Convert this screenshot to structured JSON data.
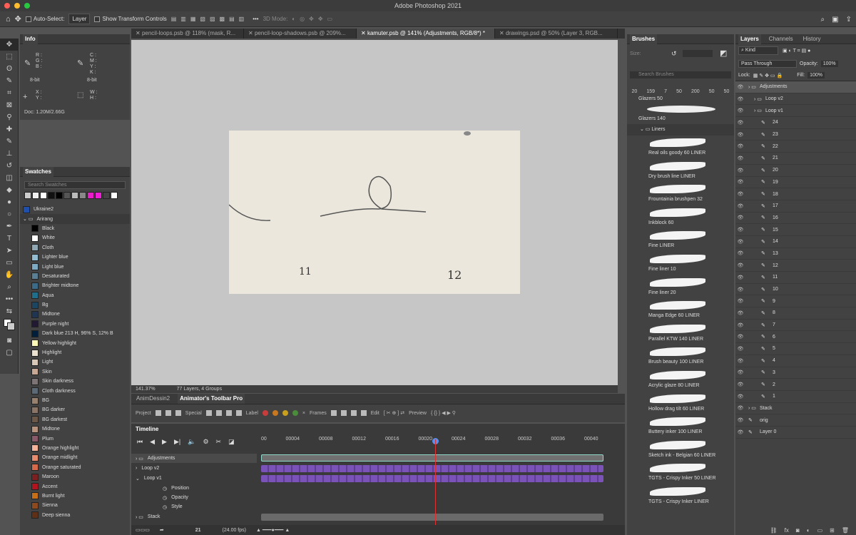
{
  "app": {
    "title": "Adobe Photoshop 2021"
  },
  "options": {
    "auto_select_label": "Auto-Select:",
    "auto_select_value": "Layer",
    "transform_label": "Show Transform Controls",
    "mode3d_label": "3D Mode:"
  },
  "doc_tabs": [
    "pencil-loops.psb @ 118% (mask, R...",
    "pencil-loop-shadows.psb @ 209%...",
    "kamuter.psb @ 141% (Adjustments, RGB/8*) *",
    "drawings.psd @ 50% (Layer 3, RGB..."
  ],
  "info": {
    "title": "Info",
    "rgb": [
      "R :",
      "G :",
      "B :"
    ],
    "cmyk": [
      "C :",
      "M :",
      "Y :",
      "K :"
    ],
    "bits": [
      "8-bit",
      "8-bit"
    ],
    "xy": [
      "X :",
      "Y :"
    ],
    "wh": [
      "W :",
      "H :"
    ],
    "doc": "Doc: 1.20M/2.66G"
  },
  "swatches": {
    "title": "Swatches",
    "search_placeholder": "Search Swatches",
    "group1": "Ukraine2",
    "group2": "Arirang",
    "colors": [
      {
        "name": "Black",
        "hex": "#000000"
      },
      {
        "name": "White",
        "hex": "#ffffff"
      },
      {
        "name": "Cloth",
        "hex": "#8fa6b3"
      },
      {
        "name": "Lighter blue",
        "hex": "#94bcd0"
      },
      {
        "name": "Light blue",
        "hex": "#7eaac4"
      },
      {
        "name": "Desaturated",
        "hex": "#5a7f94"
      },
      {
        "name": "Brighter midtone",
        "hex": "#3c6b88"
      },
      {
        "name": "Aqua",
        "hex": "#1f6e8c"
      },
      {
        "name": "Bg",
        "hex": "#1b4561"
      },
      {
        "name": "Midtone",
        "hex": "#203551"
      },
      {
        "name": "Purple night",
        "hex": "#221a33"
      },
      {
        "name": "Dark blue 213 H, 96% S, 12% B",
        "hex": "#011e3a"
      },
      {
        "name": "Yellow highlight",
        "hex": "#fff9b8"
      },
      {
        "name": "Highlight",
        "hex": "#ebe1d1"
      },
      {
        "name": "Light",
        "hex": "#d8c8b8"
      },
      {
        "name": "Skin",
        "hex": "#c7a894"
      },
      {
        "name": "Skin darkness",
        "hex": "#7d7575"
      },
      {
        "name": "Cloth darkness",
        "hex": "#5b6a75"
      },
      {
        "name": "BG",
        "hex": "#98826f"
      },
      {
        "name": "BG darker",
        "hex": "#8a7465"
      },
      {
        "name": "BG darkest",
        "hex": "#6b5849"
      },
      {
        "name": "Midtone",
        "hex": "#b8947e"
      },
      {
        "name": "Plum",
        "hex": "#8a5a6a"
      },
      {
        "name": "Orange highlight",
        "hex": "#f4b39a"
      },
      {
        "name": "Orange midlight",
        "hex": "#e88c70"
      },
      {
        "name": "Orange saturated",
        "hex": "#d46a4a"
      },
      {
        "name": "Maroon",
        "hex": "#7a2020"
      },
      {
        "name": "Accent",
        "hex": "#b0141e"
      },
      {
        "name": "Burnt light",
        "hex": "#c47018"
      },
      {
        "name": "Sienna",
        "hex": "#8c4a1e"
      },
      {
        "name": "Deep sienna",
        "hex": "#5e3018"
      }
    ]
  },
  "canvas": {
    "label_left": "11",
    "label_right": "12"
  },
  "status": {
    "zoom": "141.37%",
    "info": "77 Layers, 4 Groups"
  },
  "anim": {
    "tab1": "AnimDessin2",
    "tab2": "Animator's Toolbar Pro",
    "project": "Project",
    "special": "Special",
    "label": "Label",
    "frames": "Frames",
    "edit": "Edit",
    "preview": "Preview"
  },
  "timeline": {
    "title": "Timeline",
    "ticks": [
      "00",
      "00004",
      "00008",
      "00012",
      "00016",
      "00020",
      "00024",
      "00028",
      "00032",
      "00036",
      "00040"
    ],
    "layers": [
      "Adjustments",
      "Loop v2",
      "Loop v1",
      "Position",
      "Opacity",
      "Style",
      "Stack"
    ],
    "frame": "21",
    "fps": "(24.00 fps)"
  },
  "brushes": {
    "title": "Brushes",
    "size_label": "Size:",
    "search_placeholder": "Search Brushes",
    "presets": [
      "20",
      "159",
      "7",
      "50",
      "200",
      "50",
      "50"
    ],
    "glazers50": "Glazers 50",
    "glazers140": "Glazers 140",
    "group": "Liners",
    "items": [
      "Real oils goody 60 LINER",
      "Dry brush line LINER",
      "Frountainia brushpen 32",
      "Inkblock 60",
      "Fine LINER",
      "Fine liner 10",
      "Fine liner 20",
      "Manga Edge 60 LINER",
      "Parallel KTW 140 LINER",
      "Brush beauty 100 LINER",
      "Acrylic glaze 80 LINER",
      "Hollow drag tilt 60 LINER",
      "Buttery inker 100 LINER",
      "Sketch ink - Belgian 60 LINER",
      "TGTS - Crispy Inker 50 LINER",
      "TGTS - Crispy Inker LINER"
    ]
  },
  "layers": {
    "tabs": [
      "Layers",
      "Channels",
      "History"
    ],
    "kind": "Kind",
    "blend": "Pass Through",
    "opacity_label": "Opacity:",
    "opacity": "100%",
    "lock_label": "Lock:",
    "fill_label": "Fill:",
    "fill": "100%",
    "groups": [
      "Adjustments",
      "Loop v2",
      "Loop v1"
    ],
    "frames": [
      "24",
      "23",
      "22",
      "21",
      "20",
      "19",
      "18",
      "17",
      "16",
      "15",
      "14",
      "13",
      "12",
      "11",
      "10",
      "9",
      "8",
      "7",
      "6",
      "5",
      "4",
      "3",
      "2",
      "1"
    ],
    "tail": [
      "Stack",
      "orig",
      "Layer 0"
    ]
  }
}
